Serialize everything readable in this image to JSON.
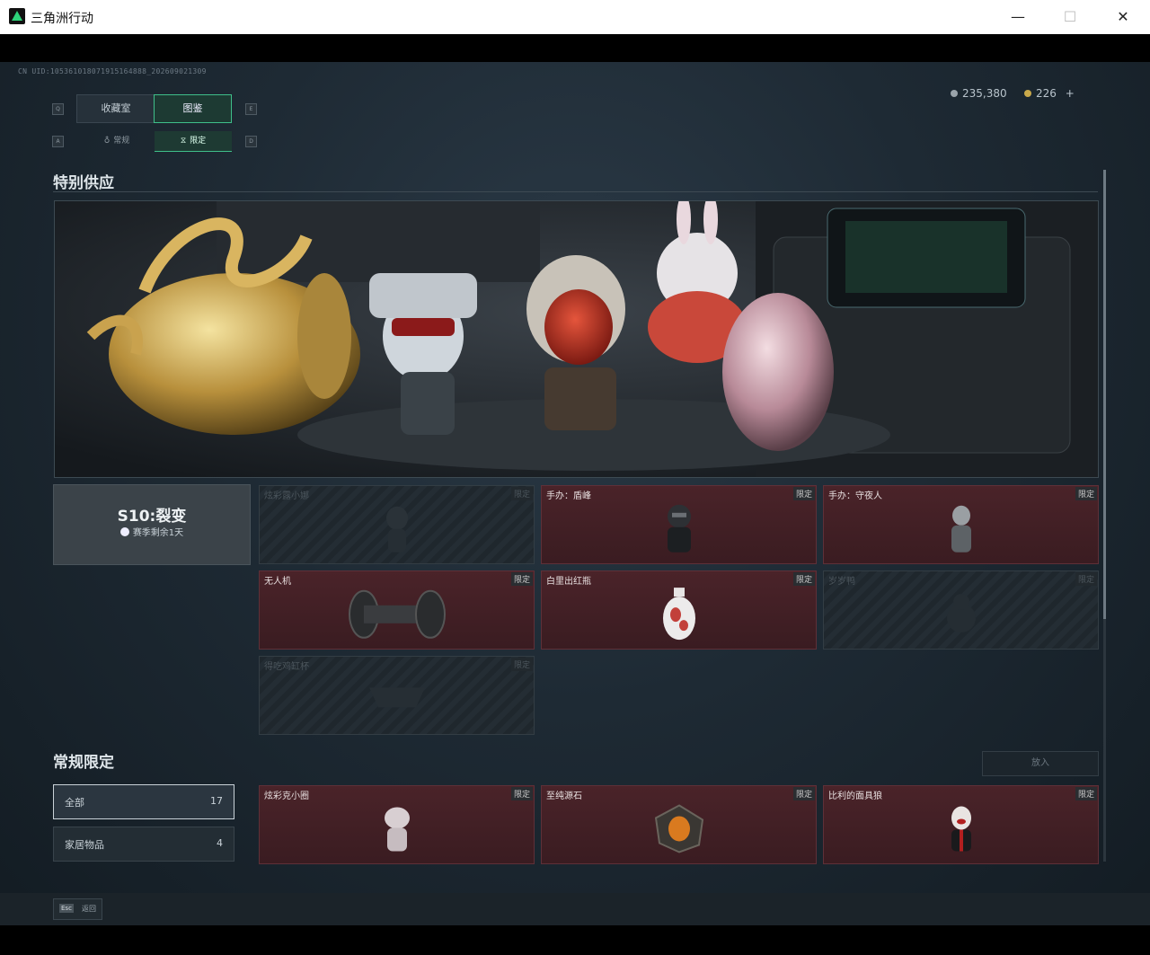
{
  "window": {
    "title": "三角洲行动",
    "minimize": "—",
    "maximize": "☐",
    "close": "✕"
  },
  "header": {
    "uid": "CN UID:105361018071915164888_202609021309",
    "currency_a": "235,380",
    "currency_b": "226",
    "add": "+"
  },
  "nav": {
    "key_left": "Q",
    "key_right": "E",
    "tabs": [
      {
        "label": "收藏室"
      },
      {
        "label": "图鉴"
      }
    ],
    "sub_key_left": "A",
    "sub_key_right": "D",
    "subtabs": [
      {
        "label": "常规"
      },
      {
        "label": "限定"
      }
    ]
  },
  "special": {
    "title": "特别供应",
    "season_name": "S10:裂变",
    "season_remaining": "赛季剩余1天",
    "badge": "限定",
    "items": [
      {
        "name": "炫彩露小娜",
        "owned": false
      },
      {
        "name": "手办：盾峰",
        "owned": true
      },
      {
        "name": "手办：守夜人",
        "owned": true
      },
      {
        "name": "无人机",
        "owned": true
      },
      {
        "name": "白里出红瓶",
        "owned": true
      },
      {
        "name": "岁岁鸭",
        "owned": false
      },
      {
        "name": "得吃鸡缸杯",
        "owned": false
      }
    ]
  },
  "regular": {
    "title": "常规限定",
    "place_button": "放入",
    "filters": [
      {
        "label": "全部",
        "count": "17"
      },
      {
        "label": "家居物品",
        "count": "4"
      }
    ],
    "items": [
      {
        "name": "炫彩克小圈",
        "owned": true
      },
      {
        "name": "至纯源石",
        "owned": true
      },
      {
        "name": "比利的面具狼",
        "owned": true
      }
    ]
  },
  "footer": {
    "esc_key": "Esc",
    "back": "返回"
  },
  "colors": {
    "accent": "#2ed37a",
    "owned_card": "#4a2329",
    "panel": "#1e2a34"
  }
}
